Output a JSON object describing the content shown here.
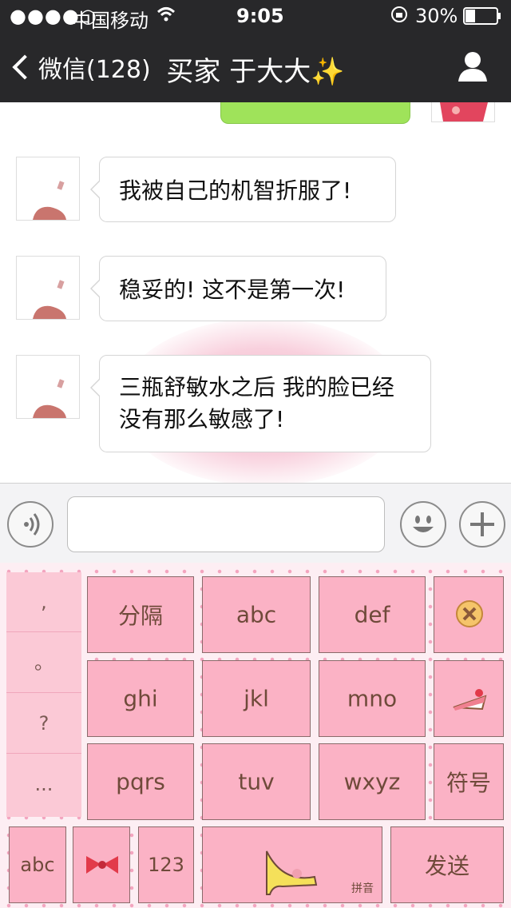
{
  "status_bar": {
    "signal": "●●●●○",
    "carrier": "中国移动",
    "time": "9:05",
    "battery": "30%"
  },
  "nav": {
    "back_label": "微信(128)",
    "title": "买家 于大大✨"
  },
  "messages": [
    {
      "text": "我被自己的机智折服了!"
    },
    {
      "text": "稳妥的! 这不是第一次!"
    },
    {
      "text": "三瓶舒敏水之后 我的脸已经没有那么敏感了!"
    }
  ],
  "input": {
    "voice_icon": "voice-icon",
    "emoji_icon": "emoji-icon",
    "plus_icon": "plus-icon",
    "value": ""
  },
  "keyboard": {
    "punctuation": [
      ",",
      "。",
      "?",
      "..."
    ],
    "row1": [
      "分隔",
      "abc",
      "def"
    ],
    "row2": [
      "ghi",
      "jkl",
      "mno"
    ],
    "row3": [
      "pqrs",
      "tuv",
      "wxyz",
      "符号"
    ],
    "bottom": {
      "abc": "abc",
      "num": "123",
      "space_sub": "拼音",
      "send": "发送"
    }
  },
  "colors": {
    "nav_bg": "#28282a",
    "bubble_green": "#9fe35a",
    "key_pink": "#fbb2c5"
  }
}
